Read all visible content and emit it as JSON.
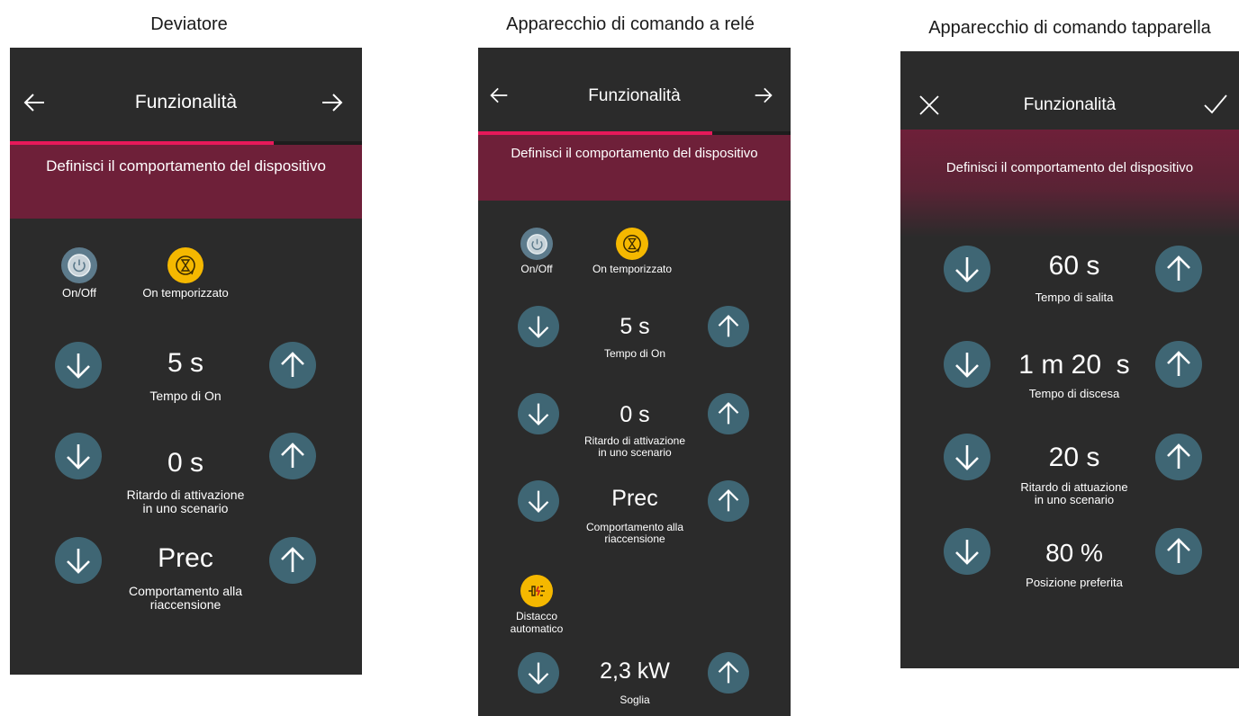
{
  "panels": [
    {
      "caption": "Deviatore",
      "title": "Funzionalità",
      "banner": "Definisci il comportamento del dispositivo",
      "progress": 0.75,
      "modes": [
        {
          "label": "On/Off",
          "icon": "power-icon"
        },
        {
          "label": "On temporizzato",
          "icon": "hourglass-icon"
        }
      ],
      "steppers": [
        {
          "value": "5 s",
          "label_lines": [
            "Tempo di On"
          ]
        },
        {
          "value": "0 s",
          "label_lines": [
            "Ritardo di attivazione",
            "in uno scenario"
          ]
        },
        {
          "value": "Prec",
          "label_lines": [
            "Comportamento alla",
            "riaccensione"
          ]
        }
      ]
    },
    {
      "caption": "Apparecchio di comando a relé",
      "title": "Funzionalità",
      "banner": "Definisci il comportamento del dispositivo",
      "progress": 0.75,
      "modes": [
        {
          "label": "On/Off",
          "icon": "power-icon"
        },
        {
          "label": "On temporizzato",
          "icon": "hourglass-icon"
        }
      ],
      "steppers": [
        {
          "value": "5 s",
          "label_lines": [
            "Tempo di On"
          ]
        },
        {
          "value": "0 s",
          "label_lines": [
            "Ritardo di attivazione",
            "in uno scenario"
          ]
        },
        {
          "value": "Prec",
          "label_lines": [
            "Comportamento alla",
            "riaccensione"
          ]
        }
      ],
      "extra_mode": {
        "label_lines": [
          "Distacco",
          "automatico"
        ],
        "icon": "load-shedding-icon"
      },
      "extra_stepper": {
        "value": "2,3 kW",
        "label_lines": [
          "Soglia"
        ]
      }
    },
    {
      "caption": "Apparecchio di comando tapparella",
      "title": "Funzionalità",
      "banner": "Definisci il comportamento del dispositivo",
      "steppers": [
        {
          "value": "60 s",
          "label_lines": [
            "Tempo di salita"
          ]
        },
        {
          "value": "1 m 20  s",
          "label_lines": [
            "Tempo di discesa"
          ]
        },
        {
          "value": "20 s",
          "label_lines": [
            "Ritardo di attuazione",
            "in uno scenario"
          ]
        },
        {
          "value": "80 %",
          "label_lines": [
            "Posizione preferita"
          ]
        }
      ]
    }
  ],
  "colors": {
    "accent": "#e6195a",
    "banner": "#6e2039",
    "stepper": "#3f6674",
    "mode_grey": "#5d7b8c",
    "mode_yellow": "#f5b800"
  }
}
